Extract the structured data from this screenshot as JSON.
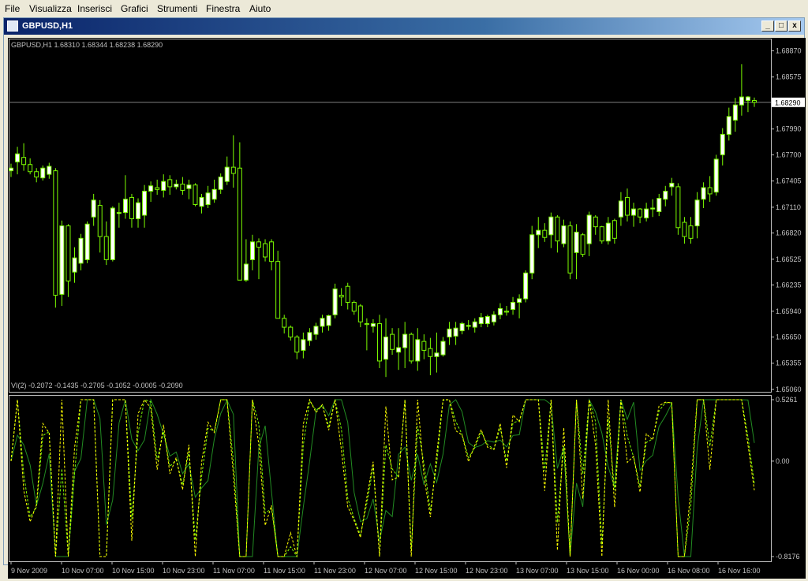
{
  "menu": [
    "File",
    "Visualizza",
    "Inserisci",
    "Grafici",
    "Strumenti",
    "Finestra",
    "Aiuto"
  ],
  "window": {
    "title": "GBPUSD,H1",
    "min_label": "_",
    "max_label": "□",
    "close_label": "x"
  },
  "main_chart": {
    "info": "GBPUSD,H1  1.68310 1.68344 1.68238 1.68290",
    "price_ticks": [
      "1.68870",
      "1.68575",
      "1.67990",
      "1.67700",
      "1.67405",
      "1.67110",
      "1.66820",
      "1.66525",
      "1.66235",
      "1.65940",
      "1.65650",
      "1.65355",
      "1.65060"
    ],
    "current_price": "1.68290"
  },
  "indicator": {
    "info": "VI(2) -0.2072 -0.1435 -0.2705 -0.1052 -0.0005 -0.2090",
    "ticks": [
      "0.5261",
      "0.00",
      "-0.8176"
    ]
  },
  "time_ticks": [
    "9 Nov 2009",
    "10 Nov 07:00",
    "10 Nov 15:00",
    "10 Nov 23:00",
    "11 Nov 07:00",
    "11 Nov 15:00",
    "11 Nov 23:00",
    "12 Nov 07:00",
    "12 Nov 15:00",
    "12 Nov 23:00",
    "13 Nov 07:00",
    "13 Nov 15:00",
    "16 Nov 00:00",
    "16 Nov 08:00",
    "16 Nov 16:00"
  ],
  "colors": {
    "background": "#000000",
    "bull_body": "#ffffff",
    "bear_body": "#000000",
    "candle_outline": "#7cfc00",
    "indicator_line_1": "#ffff00",
    "indicator_line_2": "#7cfc00",
    "indicator_line_3": "#228b22",
    "axis": "#c0c0c0"
  },
  "chart_data": {
    "type": "candlestick",
    "symbol": "GBPUSD",
    "timeframe": "H1",
    "ylim": [
      1.6506,
      1.6898
    ],
    "last": {
      "open": 1.6831,
      "high": 1.68344,
      "low": 1.68238,
      "close": 1.6829
    },
    "candles": [
      {
        "o": 1.6752,
        "h": 1.676,
        "l": 1.6745,
        "c": 1.6755
      },
      {
        "o": 1.6762,
        "h": 1.6779,
        "l": 1.6748,
        "c": 1.6771
      },
      {
        "o": 1.6767,
        "h": 1.6783,
        "l": 1.6752,
        "c": 1.6759
      },
      {
        "o": 1.6759,
        "h": 1.6766,
        "l": 1.6748,
        "c": 1.6751
      },
      {
        "o": 1.6751,
        "h": 1.6755,
        "l": 1.6739,
        "c": 1.6745
      },
      {
        "o": 1.6744,
        "h": 1.6758,
        "l": 1.6741,
        "c": 1.6755
      },
      {
        "o": 1.6748,
        "h": 1.6761,
        "l": 1.6743,
        "c": 1.6757
      },
      {
        "o": 1.6752,
        "h": 1.6755,
        "l": 1.6598,
        "c": 1.6612
      },
      {
        "o": 1.6613,
        "h": 1.6696,
        "l": 1.66,
        "c": 1.669
      },
      {
        "o": 1.669,
        "h": 1.6692,
        "l": 1.661,
        "c": 1.6628
      },
      {
        "o": 1.6638,
        "h": 1.6666,
        "l": 1.6626,
        "c": 1.6654
      },
      {
        "o": 1.6648,
        "h": 1.6681,
        "l": 1.664,
        "c": 1.6676
      },
      {
        "o": 1.6652,
        "h": 1.6695,
        "l": 1.6648,
        "c": 1.6692
      },
      {
        "o": 1.67,
        "h": 1.6726,
        "l": 1.669,
        "c": 1.6719
      },
      {
        "o": 1.6713,
        "h": 1.6719,
        "l": 1.666,
        "c": 1.6678
      },
      {
        "o": 1.6678,
        "h": 1.6695,
        "l": 1.6646,
        "c": 1.6652
      },
      {
        "o": 1.6652,
        "h": 1.6712,
        "l": 1.665,
        "c": 1.671
      },
      {
        "o": 1.6704,
        "h": 1.6716,
        "l": 1.6688,
        "c": 1.6705
      },
      {
        "o": 1.6705,
        "h": 1.6747,
        "l": 1.6698,
        "c": 1.672
      },
      {
        "o": 1.6722,
        "h": 1.6726,
        "l": 1.6688,
        "c": 1.6698
      },
      {
        "o": 1.6698,
        "h": 1.6721,
        "l": 1.6688,
        "c": 1.6716
      },
      {
        "o": 1.6702,
        "h": 1.6736,
        "l": 1.6688,
        "c": 1.6729
      },
      {
        "o": 1.6729,
        "h": 1.674,
        "l": 1.6717,
        "c": 1.6735
      },
      {
        "o": 1.6733,
        "h": 1.6742,
        "l": 1.6725,
        "c": 1.6731
      },
      {
        "o": 1.673,
        "h": 1.6748,
        "l": 1.6722,
        "c": 1.674
      },
      {
        "o": 1.6742,
        "h": 1.6747,
        "l": 1.6725,
        "c": 1.6734
      },
      {
        "o": 1.6734,
        "h": 1.6742,
        "l": 1.6731,
        "c": 1.6737
      },
      {
        "o": 1.6737,
        "h": 1.6745,
        "l": 1.6725,
        "c": 1.673
      },
      {
        "o": 1.6732,
        "h": 1.6742,
        "l": 1.672,
        "c": 1.6736
      },
      {
        "o": 1.6736,
        "h": 1.6738,
        "l": 1.6712,
        "c": 1.6714
      },
      {
        "o": 1.6712,
        "h": 1.6726,
        "l": 1.6704,
        "c": 1.6722
      },
      {
        "o": 1.6714,
        "h": 1.6735,
        "l": 1.671,
        "c": 1.6727
      },
      {
        "o": 1.672,
        "h": 1.6742,
        "l": 1.6716,
        "c": 1.6731
      },
      {
        "o": 1.6731,
        "h": 1.6749,
        "l": 1.6726,
        "c": 1.6745
      },
      {
        "o": 1.674,
        "h": 1.6768,
        "l": 1.6736,
        "c": 1.6756
      },
      {
        "o": 1.6756,
        "h": 1.6792,
        "l": 1.6733,
        "c": 1.6749
      },
      {
        "o": 1.6755,
        "h": 1.6784,
        "l": 1.6652,
        "c": 1.6629
      },
      {
        "o": 1.6629,
        "h": 1.6675,
        "l": 1.6627,
        "c": 1.6647
      },
      {
        "o": 1.6652,
        "h": 1.668,
        "l": 1.664,
        "c": 1.6672
      },
      {
        "o": 1.6672,
        "h": 1.6676,
        "l": 1.663,
        "c": 1.6666
      },
      {
        "o": 1.667,
        "h": 1.6675,
        "l": 1.665,
        "c": 1.6655
      },
      {
        "o": 1.6672,
        "h": 1.6675,
        "l": 1.664,
        "c": 1.665
      },
      {
        "o": 1.665,
        "h": 1.6662,
        "l": 1.6591,
        "c": 1.6586
      },
      {
        "o": 1.6586,
        "h": 1.659,
        "l": 1.6569,
        "c": 1.6576
      },
      {
        "o": 1.6576,
        "h": 1.6578,
        "l": 1.6561,
        "c": 1.6565
      },
      {
        "o": 1.6565,
        "h": 1.6567,
        "l": 1.654,
        "c": 1.6548
      },
      {
        "o": 1.655,
        "h": 1.657,
        "l": 1.6541,
        "c": 1.6562
      },
      {
        "o": 1.6561,
        "h": 1.6575,
        "l": 1.6555,
        "c": 1.657
      },
      {
        "o": 1.6568,
        "h": 1.6581,
        "l": 1.6562,
        "c": 1.6577
      },
      {
        "o": 1.6577,
        "h": 1.659,
        "l": 1.657,
        "c": 1.6586
      },
      {
        "o": 1.6578,
        "h": 1.659,
        "l": 1.6572,
        "c": 1.6589
      },
      {
        "o": 1.659,
        "h": 1.6625,
        "l": 1.6586,
        "c": 1.6619
      },
      {
        "o": 1.6612,
        "h": 1.662,
        "l": 1.66,
        "c": 1.661
      },
      {
        "o": 1.6622,
        "h": 1.6626,
        "l": 1.6596,
        "c": 1.6604
      },
      {
        "o": 1.6604,
        "h": 1.6606,
        "l": 1.659,
        "c": 1.6594
      },
      {
        "o": 1.66,
        "h": 1.6602,
        "l": 1.6576,
        "c": 1.6582
      },
      {
        "o": 1.658,
        "h": 1.6586,
        "l": 1.655,
        "c": 1.6579
      },
      {
        "o": 1.6577,
        "h": 1.6585,
        "l": 1.657,
        "c": 1.658
      },
      {
        "o": 1.658,
        "h": 1.659,
        "l": 1.653,
        "c": 1.6538
      },
      {
        "o": 1.654,
        "h": 1.6586,
        "l": 1.652,
        "c": 1.6565
      },
      {
        "o": 1.6568,
        "h": 1.6575,
        "l": 1.6545,
        "c": 1.6551
      },
      {
        "o": 1.6548,
        "h": 1.6575,
        "l": 1.6528,
        "c": 1.6553
      },
      {
        "o": 1.6553,
        "h": 1.6582,
        "l": 1.653,
        "c": 1.6568
      },
      {
        "o": 1.6568,
        "h": 1.657,
        "l": 1.6535,
        "c": 1.6538
      },
      {
        "o": 1.6538,
        "h": 1.6575,
        "l": 1.6527,
        "c": 1.6562
      },
      {
        "o": 1.656,
        "h": 1.6568,
        "l": 1.654,
        "c": 1.655
      },
      {
        "o": 1.6552,
        "h": 1.6564,
        "l": 1.6522,
        "c": 1.6543
      },
      {
        "o": 1.6543,
        "h": 1.657,
        "l": 1.6525,
        "c": 1.6547
      },
      {
        "o": 1.6545,
        "h": 1.6565,
        "l": 1.6543,
        "c": 1.656
      },
      {
        "o": 1.6565,
        "h": 1.6582,
        "l": 1.6556,
        "c": 1.6574
      },
      {
        "o": 1.6566,
        "h": 1.6582,
        "l": 1.6556,
        "c": 1.6575
      },
      {
        "o": 1.6572,
        "h": 1.6582,
        "l": 1.6568,
        "c": 1.658
      },
      {
        "o": 1.6577,
        "h": 1.6584,
        "l": 1.6573,
        "c": 1.6578
      },
      {
        "o": 1.6576,
        "h": 1.6586,
        "l": 1.657,
        "c": 1.6582
      },
      {
        "o": 1.658,
        "h": 1.6592,
        "l": 1.6576,
        "c": 1.6587
      },
      {
        "o": 1.658,
        "h": 1.659,
        "l": 1.6576,
        "c": 1.6588
      },
      {
        "o": 1.6582,
        "h": 1.6594,
        "l": 1.6578,
        "c": 1.659
      },
      {
        "o": 1.659,
        "h": 1.6603,
        "l": 1.6585,
        "c": 1.6597
      },
      {
        "o": 1.6594,
        "h": 1.66,
        "l": 1.6589,
        "c": 1.6593
      },
      {
        "o": 1.6596,
        "h": 1.661,
        "l": 1.659,
        "c": 1.6604
      },
      {
        "o": 1.6604,
        "h": 1.6613,
        "l": 1.6586,
        "c": 1.6608
      },
      {
        "o": 1.6608,
        "h": 1.664,
        "l": 1.6604,
        "c": 1.6637
      },
      {
        "o": 1.6637,
        "h": 1.669,
        "l": 1.663,
        "c": 1.668
      },
      {
        "o": 1.668,
        "h": 1.67,
        "l": 1.6665,
        "c": 1.6685
      },
      {
        "o": 1.6685,
        "h": 1.6693,
        "l": 1.6672,
        "c": 1.6677
      },
      {
        "o": 1.668,
        "h": 1.6705,
        "l": 1.6665,
        "c": 1.67
      },
      {
        "o": 1.67,
        "h": 1.6702,
        "l": 1.666,
        "c": 1.6673
      },
      {
        "o": 1.667,
        "h": 1.6697,
        "l": 1.6666,
        "c": 1.669
      },
      {
        "o": 1.669,
        "h": 1.6695,
        "l": 1.663,
        "c": 1.6637
      },
      {
        "o": 1.666,
        "h": 1.6692,
        "l": 1.663,
        "c": 1.6683
      },
      {
        "o": 1.668,
        "h": 1.6682,
        "l": 1.6655,
        "c": 1.6658
      },
      {
        "o": 1.667,
        "h": 1.6706,
        "l": 1.6656,
        "c": 1.6702
      },
      {
        "o": 1.67,
        "h": 1.6702,
        "l": 1.668,
        "c": 1.6689
      },
      {
        "o": 1.6689,
        "h": 1.669,
        "l": 1.667,
        "c": 1.6673
      },
      {
        "o": 1.6673,
        "h": 1.67,
        "l": 1.6669,
        "c": 1.6693
      },
      {
        "o": 1.6696,
        "h": 1.6698,
        "l": 1.667,
        "c": 1.6676
      },
      {
        "o": 1.67,
        "h": 1.6728,
        "l": 1.669,
        "c": 1.6718
      },
      {
        "o": 1.6722,
        "h": 1.6732,
        "l": 1.6695,
        "c": 1.6702
      },
      {
        "o": 1.6702,
        "h": 1.6716,
        "l": 1.6689,
        "c": 1.6709
      },
      {
        "o": 1.6709,
        "h": 1.671,
        "l": 1.6693,
        "c": 1.67
      },
      {
        "o": 1.6699,
        "h": 1.6716,
        "l": 1.6695,
        "c": 1.6709
      },
      {
        "o": 1.6709,
        "h": 1.672,
        "l": 1.67,
        "c": 1.671
      },
      {
        "o": 1.6706,
        "h": 1.6726,
        "l": 1.6701,
        "c": 1.6721
      },
      {
        "o": 1.672,
        "h": 1.6735,
        "l": 1.6712,
        "c": 1.6729
      },
      {
        "o": 1.6734,
        "h": 1.6744,
        "l": 1.6724,
        "c": 1.6738
      },
      {
        "o": 1.6734,
        "h": 1.6738,
        "l": 1.668,
        "c": 1.6688
      },
      {
        "o": 1.6694,
        "h": 1.67,
        "l": 1.667,
        "c": 1.6678
      },
      {
        "o": 1.669,
        "h": 1.67,
        "l": 1.667,
        "c": 1.6676
      },
      {
        "o": 1.669,
        "h": 1.6728,
        "l": 1.6676,
        "c": 1.6719
      },
      {
        "o": 1.672,
        "h": 1.6739,
        "l": 1.671,
        "c": 1.6733
      },
      {
        "o": 1.6733,
        "h": 1.6746,
        "l": 1.6717,
        "c": 1.6726
      },
      {
        "o": 1.6728,
        "h": 1.677,
        "l": 1.6724,
        "c": 1.6765
      },
      {
        "o": 1.677,
        "h": 1.68,
        "l": 1.6758,
        "c": 1.6793
      },
      {
        "o": 1.6793,
        "h": 1.6823,
        "l": 1.6786,
        "c": 1.6813
      },
      {
        "o": 1.6809,
        "h": 1.6834,
        "l": 1.6796,
        "c": 1.6826
      },
      {
        "o": 1.6826,
        "h": 1.6872,
        "l": 1.6814,
        "c": 1.6835
      },
      {
        "o": 1.6831,
        "h": 1.6836,
        "l": 1.6818,
        "c": 1.6835
      },
      {
        "o": 1.6831,
        "h": 1.68344,
        "l": 1.68238,
        "c": 1.6829
      }
    ]
  }
}
